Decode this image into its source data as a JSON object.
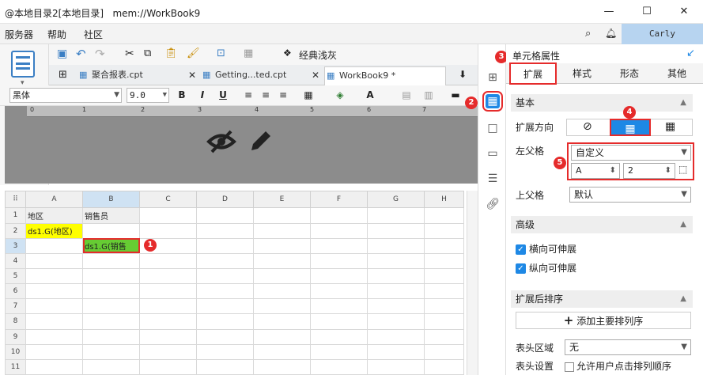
{
  "window": {
    "title": "@本地目录2[本地目录]   mem://WorkBook9",
    "minimize": "—",
    "maximize": "☐",
    "close": "✕"
  },
  "menu": {
    "items": [
      "服务器",
      "帮助",
      "社区"
    ]
  },
  "user": {
    "name": "Carly"
  },
  "toolbar": {
    "classic_label": "经典浅灰"
  },
  "tabs": [
    {
      "label": "聚合报表.cpt"
    },
    {
      "label": "Getting...ted.cpt"
    },
    {
      "label": "WorkBook9 *"
    }
  ],
  "format": {
    "font": "黑体",
    "size": "9.0"
  },
  "ruler": {
    "marks": [
      "0",
      "1",
      "2",
      "3",
      "4",
      "5",
      "6",
      "7"
    ]
  },
  "grid": {
    "columns": [
      "A",
      "B",
      "C",
      "D",
      "E",
      "F",
      "G",
      "H"
    ],
    "rows": [
      "1",
      "2",
      "3",
      "4",
      "5",
      "6",
      "7",
      "8",
      "9",
      "10",
      "11"
    ],
    "cells": {
      "A1": "地区",
      "B1": "销售员",
      "A2": "ds1.G(地区)",
      "B3": "ds1.G(销售"
    }
  },
  "badges": [
    "1",
    "2",
    "3",
    "4",
    "5"
  ],
  "panel": {
    "title": "单元格属性",
    "tabs": [
      "扩展",
      "样式",
      "形态",
      "其他"
    ],
    "sections": {
      "basic": "基本",
      "advanced": "高级",
      "sort": "扩展后排序"
    },
    "expand_dir_label": "扩展方向",
    "left_parent_label": "左父格",
    "left_parent_value": "自定义",
    "left_parent_col": "A",
    "left_parent_row": "2",
    "upper_parent_label": "上父格",
    "upper_parent_value": "默认",
    "h_expand": "横向可伸展",
    "v_expand": "纵向可伸展",
    "add_sort": "添加主要排列序",
    "header_area_label": "表头区域",
    "header_area_value": "无",
    "header_setting_label": "表头设置",
    "header_setting_option": "允许用户点击排列顺序"
  },
  "colors": {
    "accent": "#1e88e5",
    "badge": "#e52b2b",
    "cell_yellow": "#ffff00",
    "cell_green": "#66cc33"
  }
}
